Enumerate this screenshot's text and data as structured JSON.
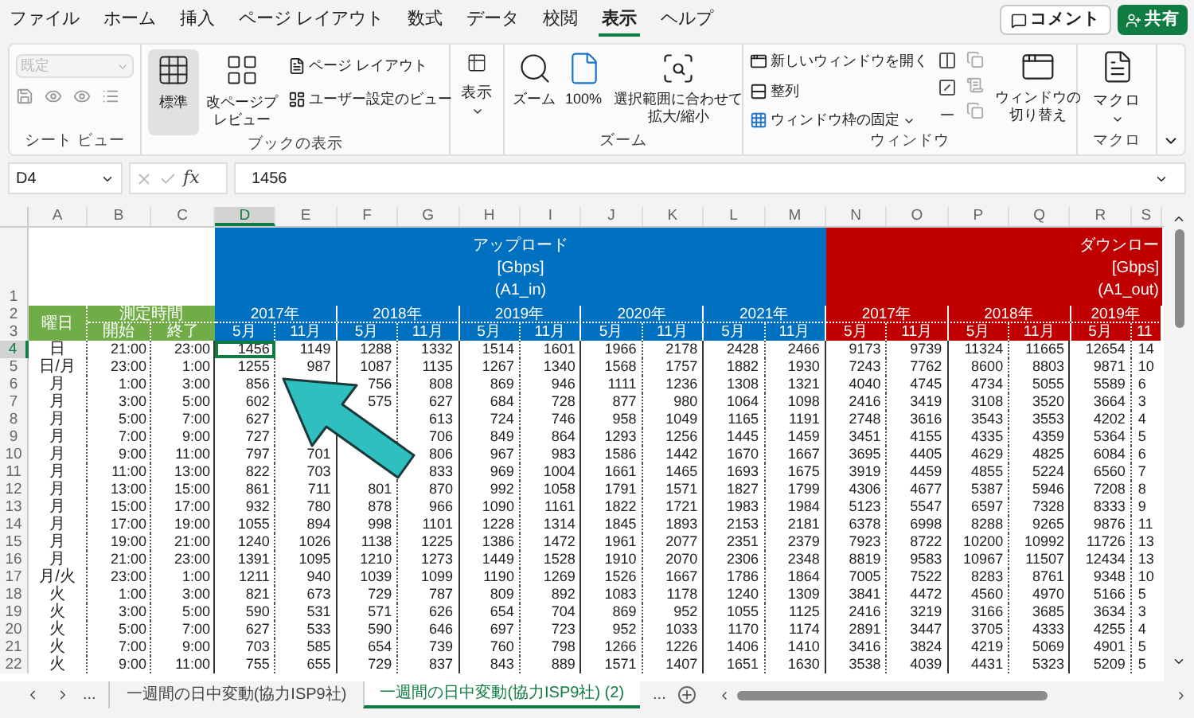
{
  "menu": [
    {
      "label": "ファイル",
      "selected": false
    },
    {
      "label": "ホーム",
      "selected": false
    },
    {
      "label": "挿入",
      "selected": false
    },
    {
      "label": "ページ レイアウト",
      "selected": false
    },
    {
      "label": "数式",
      "selected": false
    },
    {
      "label": "データ",
      "selected": false
    },
    {
      "label": "校閲",
      "selected": false
    },
    {
      "label": "表示",
      "selected": true
    },
    {
      "label": "ヘルプ",
      "selected": false
    }
  ],
  "comment_button": "コメント",
  "share_button": "共有",
  "ribbon": {
    "sheet_view": {
      "dropdown": "既定",
      "dropdown_disabled": true,
      "label": "シート ビュー"
    },
    "workbook_views": {
      "large": [
        {
          "label": "標準",
          "selected": true
        },
        {
          "label": "改ページプレビュー",
          "selected": false
        }
      ],
      "small": [
        "ページ レイアウト",
        "ユーザー設定のビュー"
      ],
      "label": "ブックの表示"
    },
    "show": {
      "label": "表示"
    },
    "zoom": {
      "buttons": [
        "ズーム",
        "100%",
        "選択範囲に合わせて拡大/縮小"
      ],
      "label": "ズーム"
    },
    "window": {
      "small": [
        "新しいウィンドウを開く",
        "整列",
        "ウィンドウ枠の固定"
      ],
      "switch": "ウィンドウの切り替え",
      "label": "ウィンドウ"
    },
    "macro": {
      "button": "マクロ",
      "label": "マクロ"
    }
  },
  "name_box": "D4",
  "function_label": "fx",
  "formula": "1456",
  "columns": [
    {
      "letter": "A",
      "selected": false
    },
    {
      "letter": "B",
      "selected": false
    },
    {
      "letter": "C",
      "selected": false
    },
    {
      "letter": "D",
      "selected": true
    },
    {
      "letter": "E",
      "selected": false
    },
    {
      "letter": "F",
      "selected": false
    },
    {
      "letter": "G",
      "selected": false
    },
    {
      "letter": "H",
      "selected": false
    },
    {
      "letter": "I",
      "selected": false
    },
    {
      "letter": "J",
      "selected": false
    },
    {
      "letter": "K",
      "selected": false
    },
    {
      "letter": "L",
      "selected": false
    },
    {
      "letter": "M",
      "selected": false
    },
    {
      "letter": "N",
      "selected": false
    },
    {
      "letter": "O",
      "selected": false
    },
    {
      "letter": "P",
      "selected": false
    },
    {
      "letter": "Q",
      "selected": false
    },
    {
      "letter": "R",
      "selected": false
    },
    {
      "letter": "S",
      "selected": false
    }
  ],
  "header_rows": [
    "1",
    "2",
    "3"
  ],
  "labels": {
    "day": "曜日",
    "time": "測定時間",
    "start": "開始",
    "end": "終了"
  },
  "upload": {
    "title": [
      "アップロード",
      "[Gbps]",
      "(A1_in)"
    ],
    "years": [
      "2017年",
      "2018年",
      "2019年",
      "2020年",
      "2021年"
    ],
    "months": [
      "5月",
      "11月",
      "5月",
      "11月",
      "5月",
      "11月",
      "5月",
      "11月",
      "5月",
      "11月"
    ]
  },
  "download": {
    "title": [
      "ダウンロー",
      "[Gbps]",
      "(A1_out)"
    ],
    "years": [
      "2017年",
      "2018年",
      "2019年"
    ],
    "months": [
      "5月",
      "11月",
      "5月",
      "11月",
      "5月",
      "11"
    ]
  },
  "rows": [
    {
      "number": "4",
      "selected": true,
      "day": "日",
      "start": "21:00",
      "end": "23:00",
      "col_d": "1456",
      "col_e": "1149",
      "col_f": "1288",
      "col_g": "1332",
      "col_h": "1514",
      "col_i": "1601",
      "col_j": "1966",
      "col_k": "2178",
      "col_l": "2428",
      "col_m": "2466",
      "col_n": "9173",
      "col_o": "9739",
      "col_p": "11324",
      "col_q": "11665",
      "col_r": "12654",
      "col_s": "14"
    },
    {
      "number": "5",
      "selected": false,
      "day": "日/月",
      "start": "23:00",
      "end": "1:00",
      "col_d": "1255",
      "col_e": "987",
      "col_f": "1087",
      "col_g": "1135",
      "col_h": "1267",
      "col_i": "1340",
      "col_j": "1568",
      "col_k": "1757",
      "col_l": "1882",
      "col_m": "1930",
      "col_n": "7243",
      "col_o": "7762",
      "col_p": "8600",
      "col_q": "8803",
      "col_r": "9871",
      "col_s": "10"
    },
    {
      "number": "6",
      "selected": false,
      "day": "月",
      "start": "1:00",
      "end": "3:00",
      "col_d": "856",
      "col_f": "756",
      "col_g": "808",
      "col_h": "869",
      "col_i": "946",
      "col_j": "1111",
      "col_k": "1236",
      "col_l": "1308",
      "col_m": "1321",
      "col_n": "4040",
      "col_o": "4745",
      "col_p": "4734",
      "col_q": "5055",
      "col_r": "5589",
      "col_s": "6"
    },
    {
      "number": "7",
      "selected": false,
      "day": "月",
      "start": "3:00",
      "end": "5:00",
      "col_d": "602",
      "col_f": "575",
      "col_g": "627",
      "col_h": "684",
      "col_i": "728",
      "col_j": "877",
      "col_k": "980",
      "col_l": "1064",
      "col_m": "1098",
      "col_n": "2416",
      "col_o": "3419",
      "col_p": "3108",
      "col_q": "3520",
      "col_r": "3664",
      "col_s": "3"
    },
    {
      "number": "8",
      "selected": false,
      "day": "月",
      "start": "5:00",
      "end": "7:00",
      "col_d": "627",
      "col_g": "613",
      "col_h": "724",
      "col_i": "746",
      "col_j": "958",
      "col_k": "1049",
      "col_l": "1165",
      "col_m": "1191",
      "col_n": "2748",
      "col_o": "3616",
      "col_p": "3543",
      "col_q": "3553",
      "col_r": "4202",
      "col_s": "4"
    },
    {
      "number": "9",
      "selected": false,
      "day": "月",
      "start": "7:00",
      "end": "9:00",
      "col_d": "727",
      "col_g": "706",
      "col_h": "849",
      "col_i": "864",
      "col_j": "1293",
      "col_k": "1256",
      "col_l": "1445",
      "col_m": "1459",
      "col_n": "3451",
      "col_o": "4155",
      "col_p": "4335",
      "col_q": "4359",
      "col_r": "5364",
      "col_s": "5"
    },
    {
      "number": "10",
      "selected": false,
      "day": "月",
      "start": "9:00",
      "end": "11:00",
      "col_d": "797",
      "col_e": "701",
      "col_g": "806",
      "col_h": "967",
      "col_i": "983",
      "col_j": "1586",
      "col_k": "1442",
      "col_l": "1670",
      "col_m": "1667",
      "col_n": "3695",
      "col_o": "4405",
      "col_p": "4629",
      "col_q": "4825",
      "col_r": "6084",
      "col_s": "6"
    },
    {
      "number": "11",
      "selected": false,
      "day": "月",
      "start": "11:00",
      "end": "13:00",
      "col_d": "822",
      "col_e": "703",
      "col_g": "833",
      "col_h": "969",
      "col_i": "1004",
      "col_j": "1661",
      "col_k": "1465",
      "col_l": "1693",
      "col_m": "1675",
      "col_n": "3919",
      "col_o": "4459",
      "col_p": "4855",
      "col_q": "5224",
      "col_r": "6560",
      "col_s": "7"
    },
    {
      "number": "12",
      "selected": false,
      "day": "月",
      "start": "13:00",
      "end": "15:00",
      "col_d": "861",
      "col_e": "711",
      "col_f": "801",
      "col_g": "870",
      "col_h": "992",
      "col_i": "1058",
      "col_j": "1791",
      "col_k": "1571",
      "col_l": "1827",
      "col_m": "1799",
      "col_n": "4306",
      "col_o": "4677",
      "col_p": "5387",
      "col_q": "5946",
      "col_r": "7208",
      "col_s": "8"
    },
    {
      "number": "13",
      "selected": false,
      "day": "月",
      "start": "15:00",
      "end": "17:00",
      "col_d": "932",
      "col_e": "780",
      "col_f": "878",
      "col_g": "966",
      "col_h": "1090",
      "col_i": "1161",
      "col_j": "1822",
      "col_k": "1721",
      "col_l": "1983",
      "col_m": "1984",
      "col_n": "5123",
      "col_o": "5547",
      "col_p": "6597",
      "col_q": "7328",
      "col_r": "8333",
      "col_s": "9"
    },
    {
      "number": "14",
      "selected": false,
      "day": "月",
      "start": "17:00",
      "end": "19:00",
      "col_d": "1055",
      "col_e": "894",
      "col_f": "998",
      "col_g": "1101",
      "col_h": "1228",
      "col_i": "1314",
      "col_j": "1845",
      "col_k": "1893",
      "col_l": "2153",
      "col_m": "2181",
      "col_n": "6378",
      "col_o": "6998",
      "col_p": "8288",
      "col_q": "9265",
      "col_r": "9876",
      "col_s": "11"
    },
    {
      "number": "15",
      "selected": false,
      "day": "月",
      "start": "19:00",
      "end": "21:00",
      "col_d": "1240",
      "col_e": "1026",
      "col_f": "1138",
      "col_g": "1225",
      "col_h": "1386",
      "col_i": "1472",
      "col_j": "1961",
      "col_k": "2077",
      "col_l": "2351",
      "col_m": "2379",
      "col_n": "7923",
      "col_o": "8722",
      "col_p": "10200",
      "col_q": "10992",
      "col_r": "11726",
      "col_s": "13"
    },
    {
      "number": "16",
      "selected": false,
      "day": "月",
      "start": "21:00",
      "end": "23:00",
      "col_d": "1391",
      "col_e": "1095",
      "col_f": "1210",
      "col_g": "1273",
      "col_h": "1449",
      "col_i": "1528",
      "col_j": "1910",
      "col_k": "2070",
      "col_l": "2306",
      "col_m": "2348",
      "col_n": "8819",
      "col_o": "9583",
      "col_p": "10967",
      "col_q": "11507",
      "col_r": "12434",
      "col_s": "13"
    },
    {
      "number": "17",
      "selected": false,
      "day": "月/火",
      "start": "23:00",
      "end": "1:00",
      "col_d": "1211",
      "col_e": "940",
      "col_f": "1039",
      "col_g": "1099",
      "col_h": "1190",
      "col_i": "1269",
      "col_j": "1526",
      "col_k": "1667",
      "col_l": "1786",
      "col_m": "1864",
      "col_n": "7005",
      "col_o": "7522",
      "col_p": "8283",
      "col_q": "8761",
      "col_r": "9348",
      "col_s": "10"
    },
    {
      "number": "18",
      "selected": false,
      "day": "火",
      "start": "1:00",
      "end": "3:00",
      "col_d": "821",
      "col_e": "673",
      "col_f": "729",
      "col_g": "787",
      "col_h": "809",
      "col_i": "892",
      "col_j": "1083",
      "col_k": "1178",
      "col_l": "1240",
      "col_m": "1309",
      "col_n": "3841",
      "col_o": "4472",
      "col_p": "4560",
      "col_q": "4970",
      "col_r": "5166",
      "col_s": "5"
    },
    {
      "number": "19",
      "selected": false,
      "day": "火",
      "start": "3:00",
      "end": "5:00",
      "col_d": "590",
      "col_e": "531",
      "col_f": "571",
      "col_g": "626",
      "col_h": "654",
      "col_i": "704",
      "col_j": "869",
      "col_k": "952",
      "col_l": "1055",
      "col_m": "1125",
      "col_n": "2416",
      "col_o": "3219",
      "col_p": "3166",
      "col_q": "3685",
      "col_r": "3634",
      "col_s": "3"
    },
    {
      "number": "20",
      "selected": false,
      "day": "火",
      "start": "5:00",
      "end": "7:00",
      "col_d": "627",
      "col_e": "533",
      "col_f": "590",
      "col_g": "646",
      "col_h": "697",
      "col_i": "723",
      "col_j": "952",
      "col_k": "1033",
      "col_l": "1170",
      "col_m": "1174",
      "col_n": "2891",
      "col_o": "3447",
      "col_p": "3705",
      "col_q": "4333",
      "col_r": "4255",
      "col_s": "4"
    },
    {
      "number": "21",
      "selected": false,
      "day": "火",
      "start": "7:00",
      "end": "9:00",
      "col_d": "703",
      "col_e": "585",
      "col_f": "654",
      "col_g": "739",
      "col_h": "760",
      "col_i": "798",
      "col_j": "1266",
      "col_k": "1226",
      "col_l": "1406",
      "col_m": "1410",
      "col_n": "3416",
      "col_o": "3824",
      "col_p": "4219",
      "col_q": "5069",
      "col_r": "4901",
      "col_s": "5"
    },
    {
      "number": "22",
      "selected": false,
      "day": "火",
      "start": "9:00",
      "end": "11:00",
      "col_d": "755",
      "col_e": "655",
      "col_f": "729",
      "col_g": "837",
      "col_h": "843",
      "col_i": "889",
      "col_j": "1571",
      "col_k": "1407",
      "col_l": "1651",
      "col_m": "1630",
      "col_n": "3538",
      "col_o": "4039",
      "col_p": "4431",
      "col_q": "5323",
      "col_r": "5209",
      "col_s": "5"
    }
  ],
  "sheet_tabs": [
    {
      "label": "一週間の日中変動(協力ISP9社)",
      "selected": false
    },
    {
      "label": "一週間の日中変動(協力ISP9社) (2)",
      "selected": true
    }
  ],
  "tabs_more_left": "...",
  "tabs_more_right": "..."
}
